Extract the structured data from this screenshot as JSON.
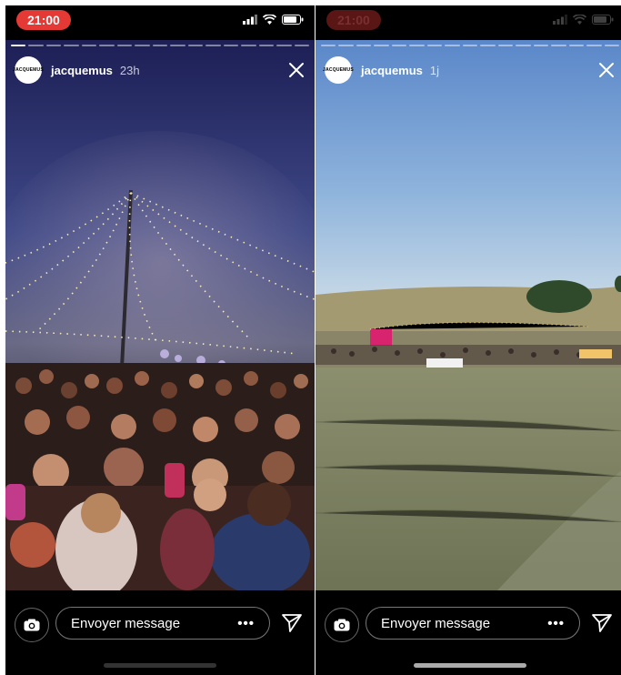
{
  "stories": [
    {
      "status_time": "21:00",
      "account": "jacquemus",
      "avatar_text": "JACQUEMUS",
      "age": "23h",
      "scene": "concert-crowd-string-lights",
      "progress_total": 17,
      "progress_done": 1,
      "message_placeholder": "Envoyer message",
      "more_icon": "ellipsis-icon"
    },
    {
      "status_time": "21:00",
      "account": "jacquemus",
      "avatar_text": "JACQUEMUS",
      "age": "1j",
      "scene": "field-party-crowd-dusk",
      "progress_total": 17,
      "progress_done": 0,
      "message_placeholder": "Envoyer message",
      "more_icon": "ellipsis-icon"
    }
  ],
  "colors": {
    "status_time_bg": "#e53935",
    "bar_bg": "#000000",
    "text": "#ffffff"
  }
}
